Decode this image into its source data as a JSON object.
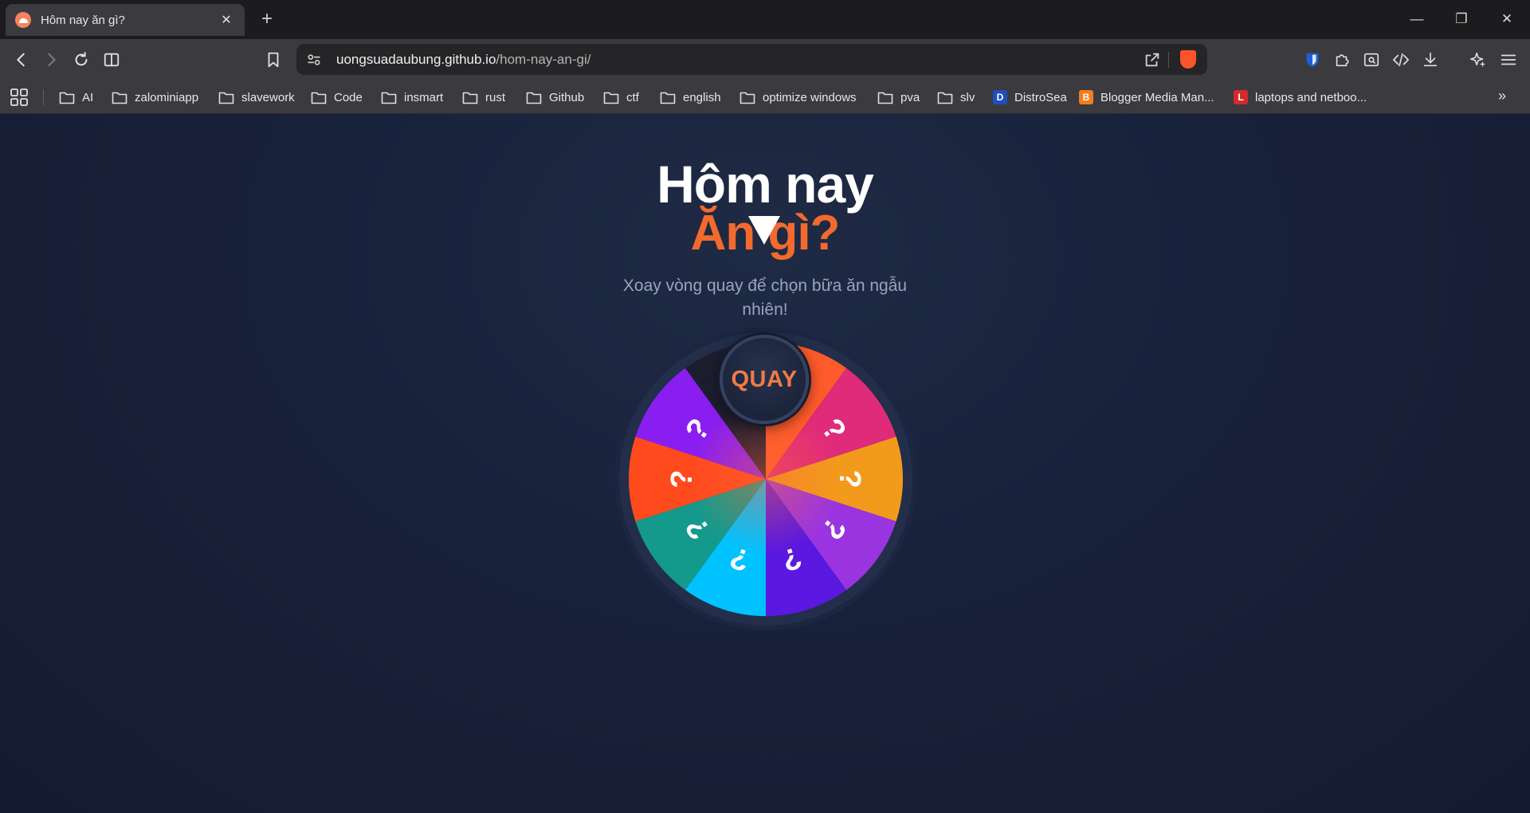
{
  "browser": {
    "tab_title": "Hôm nay ăn gì?",
    "url_host": "uongsuadaubung.github.io",
    "url_path": "/hom-nay-an-gi/",
    "bookmarks": [
      {
        "label": "AI",
        "kind": "folder"
      },
      {
        "label": "zalominiapp",
        "kind": "folder"
      },
      {
        "label": "slavework",
        "kind": "folder"
      },
      {
        "label": "Code",
        "kind": "folder"
      },
      {
        "label": "insmart",
        "kind": "folder"
      },
      {
        "label": "rust",
        "kind": "folder"
      },
      {
        "label": "Github",
        "kind": "folder"
      },
      {
        "label": "ctf",
        "kind": "folder"
      },
      {
        "label": "english",
        "kind": "folder"
      },
      {
        "label": "optimize windows",
        "kind": "folder"
      },
      {
        "label": "pva",
        "kind": "folder"
      },
      {
        "label": "slv",
        "kind": "folder"
      },
      {
        "label": "DistroSea",
        "kind": "site",
        "badge": "D",
        "color": "#1f4fbf"
      },
      {
        "label": "Blogger Media Man...",
        "kind": "site",
        "badge": "B",
        "color": "#f57c1f"
      },
      {
        "label": "laptops and netboo...",
        "kind": "site",
        "badge": "L",
        "color": "#d62a2a"
      }
    ]
  },
  "page": {
    "title_line1": "Hôm nay",
    "title_line2": "Ăn gì?",
    "subtitle": "Xoay vòng quay để chọn bữa ăn ngẫu nhiên!",
    "spin_label": "QUAY",
    "accent_color": "#f26a2e"
  },
  "wheel": {
    "segment_label": "?",
    "segments": [
      {
        "color": "#ff5a2a"
      },
      {
        "color": "#e02a7a"
      },
      {
        "color": "#f29a1c"
      },
      {
        "color": "#9a34e0"
      },
      {
        "color": "#5a18e0"
      },
      {
        "color": "#00c2ff"
      },
      {
        "color": "#149a8c"
      },
      {
        "color": "#ff4a1e"
      },
      {
        "color": "#8a1ef0"
      },
      {
        "color": "#1d1d30"
      }
    ]
  }
}
